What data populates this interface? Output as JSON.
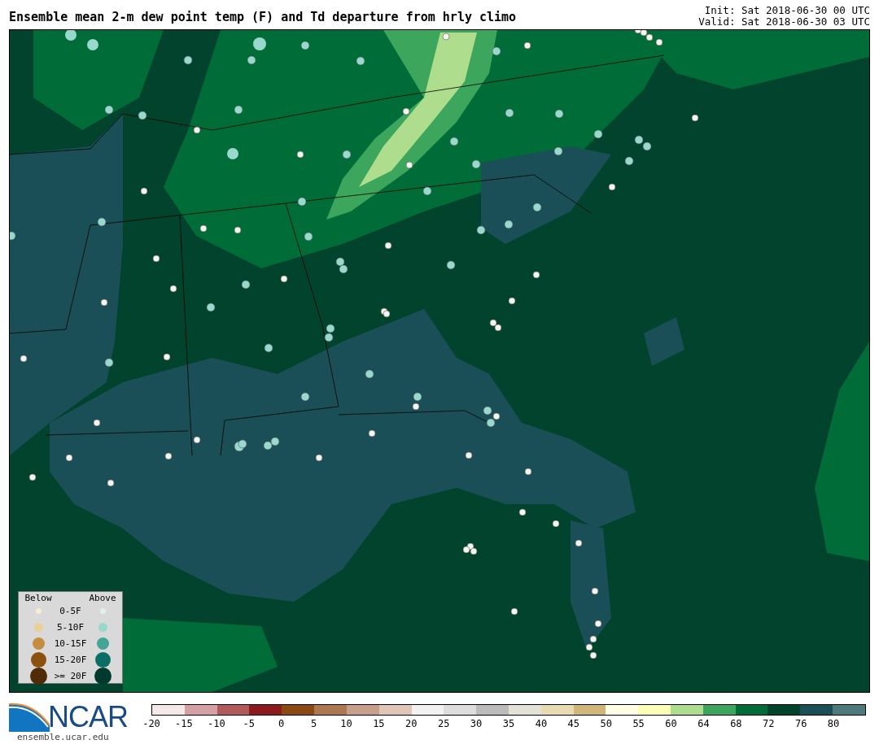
{
  "title": "Ensemble mean 2-m dew point temp (F) and Td departure from hrly climo",
  "init": "Init: Sat 2018-06-30 00 UTC",
  "valid": "Valid: Sat 2018-06-30 03 UTC",
  "legend": {
    "below_label": "Below",
    "above_label": "Above",
    "rows": [
      {
        "label": "0-5F",
        "below": {
          "color": "#f6ecd6"
        },
        "above": {
          "color": "#dff0ee"
        }
      },
      {
        "label": "5-10F",
        "below": {
          "color": "#e9cf98"
        },
        "above": {
          "color": "#99d8cd"
        }
      },
      {
        "label": "10-15F",
        "below": {
          "color": "#c58d40"
        },
        "above": {
          "color": "#44a597"
        }
      },
      {
        "label": "15-20F",
        "below": {
          "color": "#8b520f"
        },
        "above": {
          "color": "#0a6e64"
        }
      },
      {
        "label": ">= 20F",
        "below": {
          "color": "#4f2c05"
        },
        "above": {
          "color": "#003a2f"
        }
      }
    ]
  },
  "logo": {
    "text": "NCAR",
    "url": "ensemble.ucar.edu"
  },
  "colorbar": {
    "segments": [
      {
        "color": "#f5e8e8"
      },
      {
        "color": "#d4a0a4"
      },
      {
        "color": "#b05a5c"
      },
      {
        "color": "#8c1a1f"
      },
      {
        "color": "#8a4a12"
      },
      {
        "color": "#ab7850"
      },
      {
        "color": "#c6a08a"
      },
      {
        "color": "#dfc6b6"
      },
      {
        "color": "#f2f2f2"
      },
      {
        "color": "#dddddd"
      },
      {
        "color": "#bbbbbb"
      },
      {
        "color": "#e2e3d6"
      },
      {
        "color": "#e6dbb1"
      },
      {
        "color": "#d0b677"
      },
      {
        "color": "#fffde3"
      },
      {
        "color": "#f9ffb5"
      },
      {
        "color": "#aede8d"
      },
      {
        "color": "#3ca65c"
      },
      {
        "color": "#006d38"
      },
      {
        "color": "#01432d"
      },
      {
        "color": "#1b4f57"
      },
      {
        "color": "#4f7a7c"
      }
    ],
    "ticks": [
      "-20",
      "-15",
      "-10",
      "-5",
      "0",
      "5",
      "10",
      "15",
      "20",
      "25",
      "30",
      "35",
      "40",
      "45",
      "50",
      "55",
      "60",
      "64",
      "68",
      "72",
      "76",
      "80"
    ]
  }
}
